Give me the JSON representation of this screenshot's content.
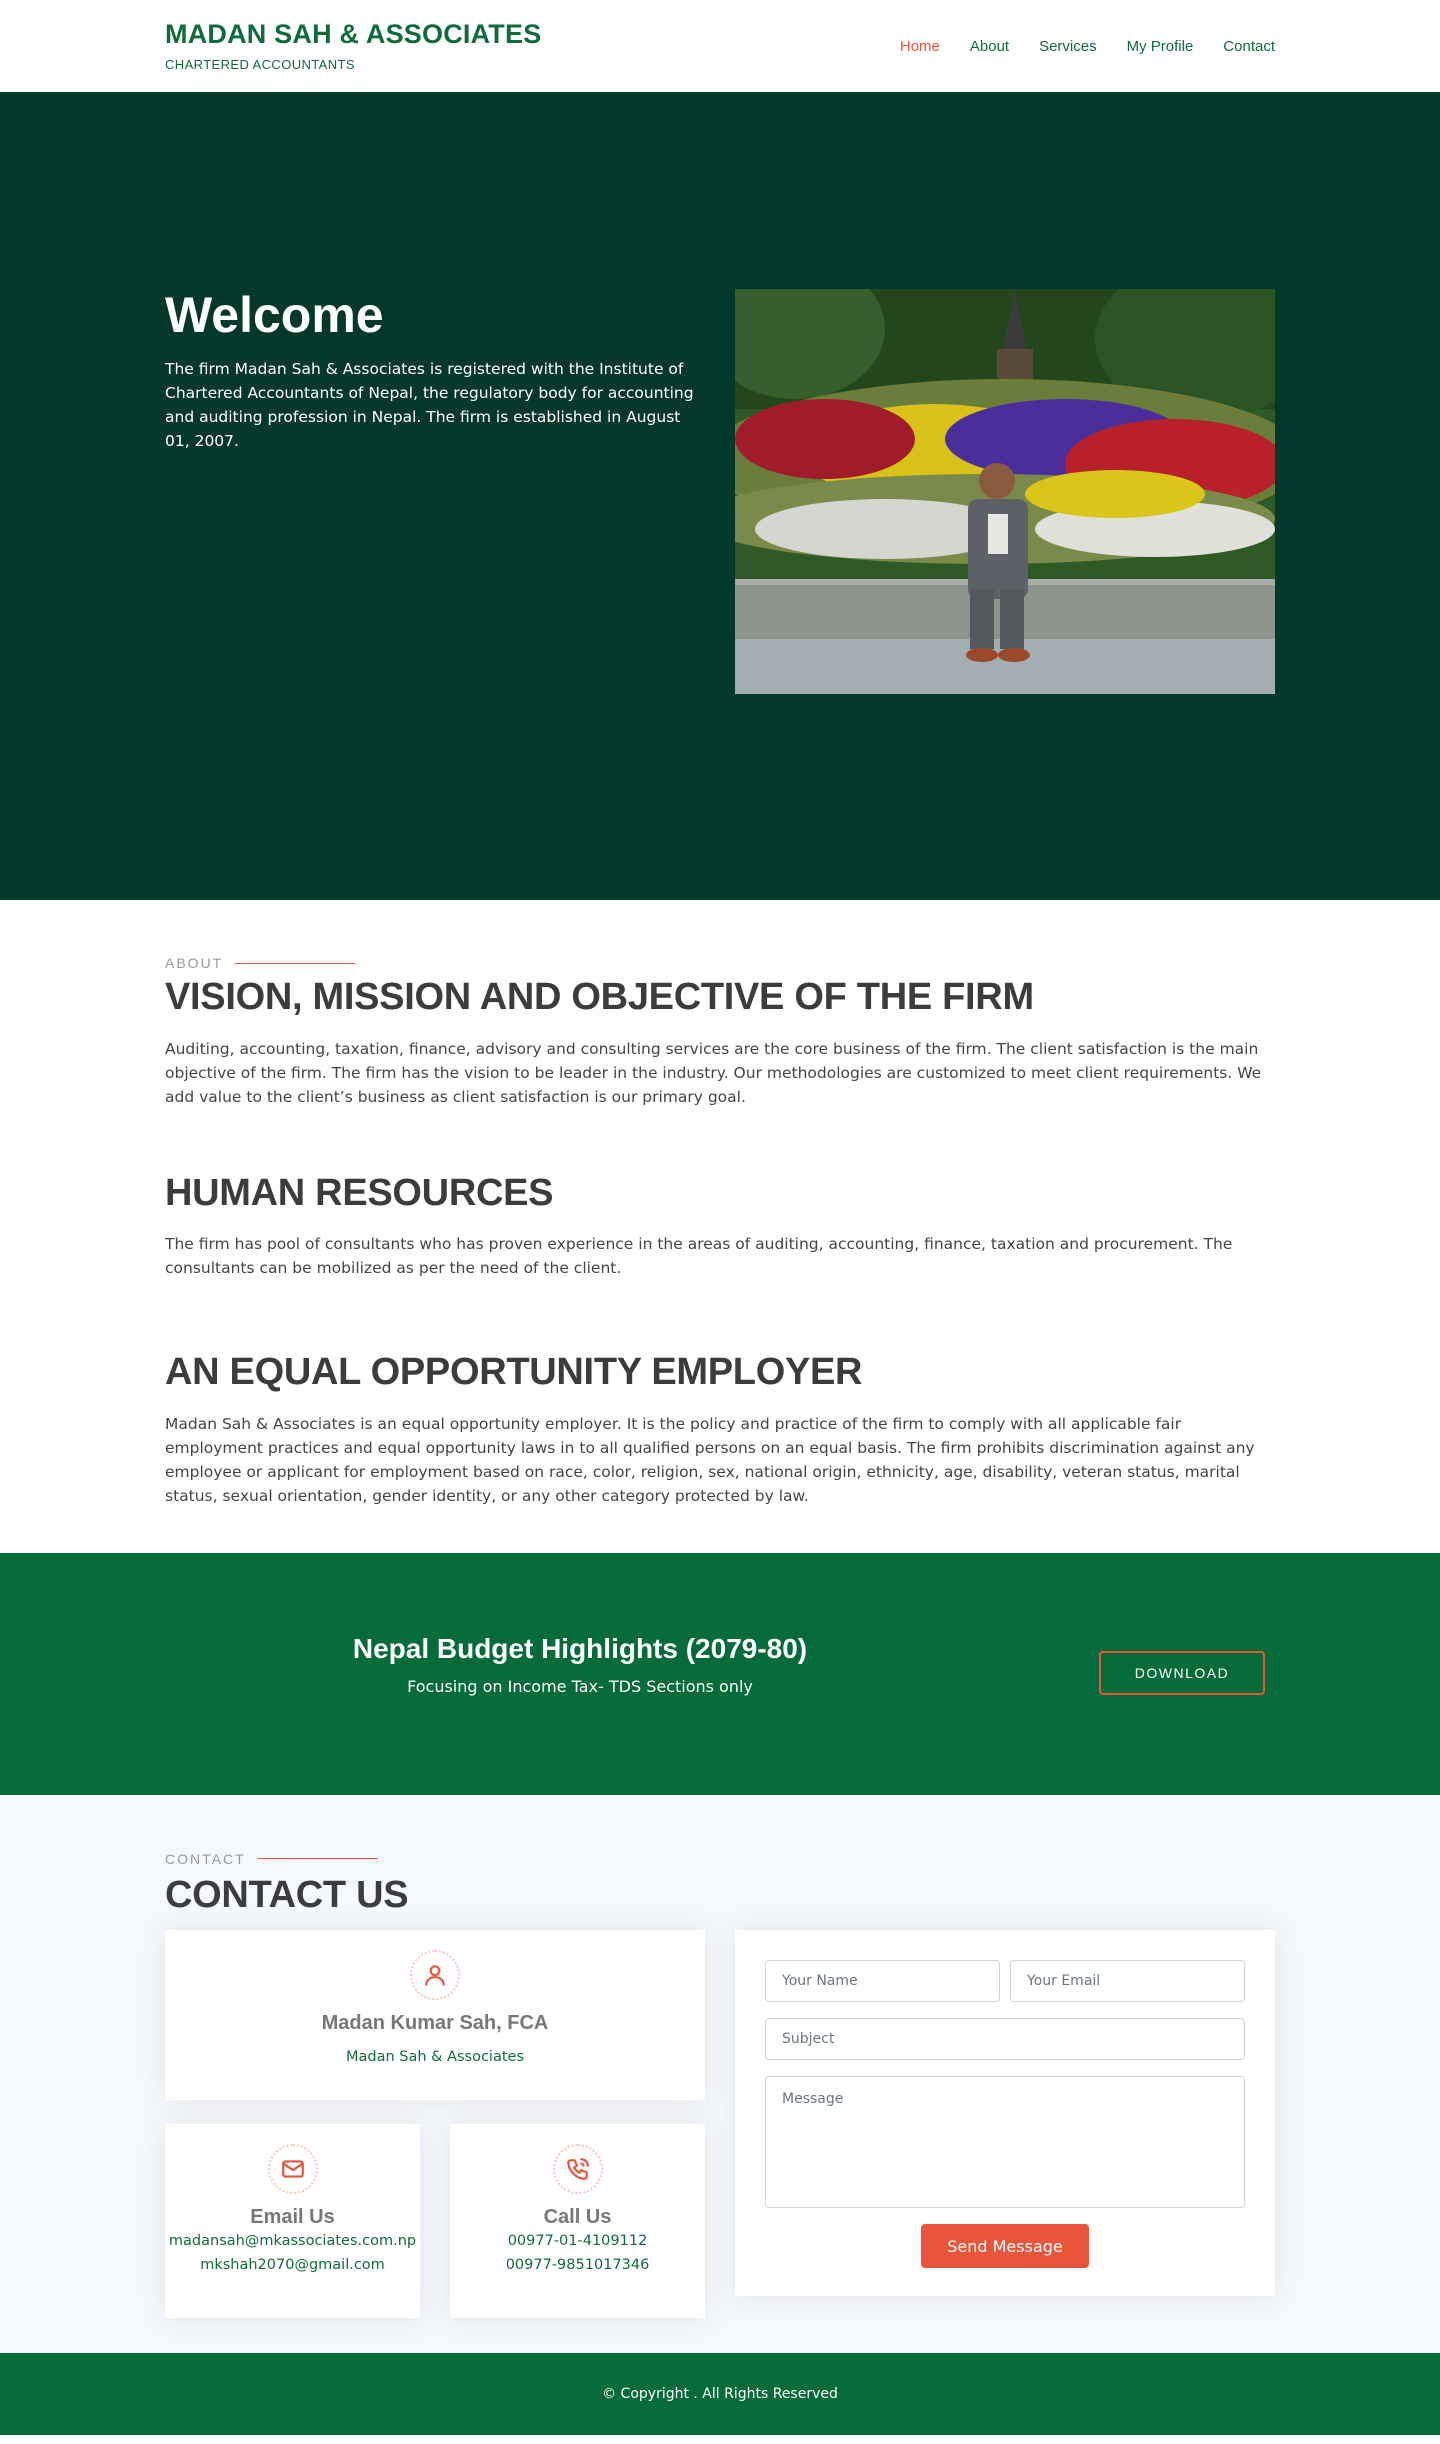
{
  "header": {
    "logo_title": "MADAN SAH & ASSOCIATES",
    "logo_subtitle": "CHARTERED ACCOUNTANTS",
    "nav": [
      "Home",
      "About",
      "Services",
      "My Profile",
      "Contact"
    ],
    "active_nav": "Home"
  },
  "hero": {
    "title": "Welcome",
    "description": "The firm Madan Sah & Associates is registered with the Institute of Chartered Accountants of Nepal, the regulatory body for accounting and auditing profession in Nepal. The firm is established in August 01, 2007."
  },
  "about": {
    "tag": "ABOUT",
    "vision_title": "VISION, MISSION AND OBJECTIVE OF THE FIRM",
    "vision_text": "Auditing, accounting, taxation, finance, advisory and consulting services are the core business of the firm. The client satisfaction is the main objective of the firm. The firm has the vision to be leader in the industry. Our methodologies are customized to meet client requirements. We add value to the client’s business as client satisfaction is our primary goal.",
    "hr_title": "HUMAN RESOURCES",
    "hr_text": "The firm has pool of consultants who has proven experience in the areas of auditing, accounting, finance, taxation and procurement. The consultants can be mobilized as per the need of the client.",
    "eq_title": "AN EQUAL OPPORTUNITY EMPLOYER",
    "eq_text": "Madan Sah & Associates is an equal opportunity employer. It is the policy and practice of the firm to comply with all applicable fair employment practices and equal opportunity laws in to all qualified persons on an equal basis. The firm prohibits discrimination against any employee or applicant for employment based on race, color, religion, sex, national origin, ethnicity, age, disability, veteran status, marital status, sexual orientation, gender identity, or any other category protected by law."
  },
  "cta": {
    "title": "Nepal Budget Highlights (2079-80)",
    "subtitle": "Focusing on Income Tax- TDS Sections only",
    "button": "DOWNLOAD"
  },
  "contact": {
    "tag": "CONTACT",
    "title": "CONTACT US",
    "person": {
      "name": "Madan Kumar Sah, FCA",
      "firm": "Madan Sah & Associates"
    },
    "email": {
      "title": "Email Us",
      "lines": [
        "madansah@mkassociates.com.np",
        "mkshah2070@gmail.com"
      ]
    },
    "call": {
      "title": "Call Us",
      "lines": [
        "00977-01-4109112",
        "00977-9851017346"
      ]
    },
    "form": {
      "name_placeholder": "Your Name",
      "email_placeholder": "Your Email",
      "subject_placeholder": "Subject",
      "message_placeholder": "Message",
      "submit": "Send Message"
    }
  },
  "footer": {
    "copyright": "© Copyright . All Rights Reserved"
  },
  "colors": {
    "brand_green": "#106b3b",
    "hero_bg": "#04382a",
    "band_green": "#046b39",
    "accent": "#e9553a"
  },
  "icons": [
    "user-icon",
    "envelope-icon",
    "phone-icon"
  ]
}
